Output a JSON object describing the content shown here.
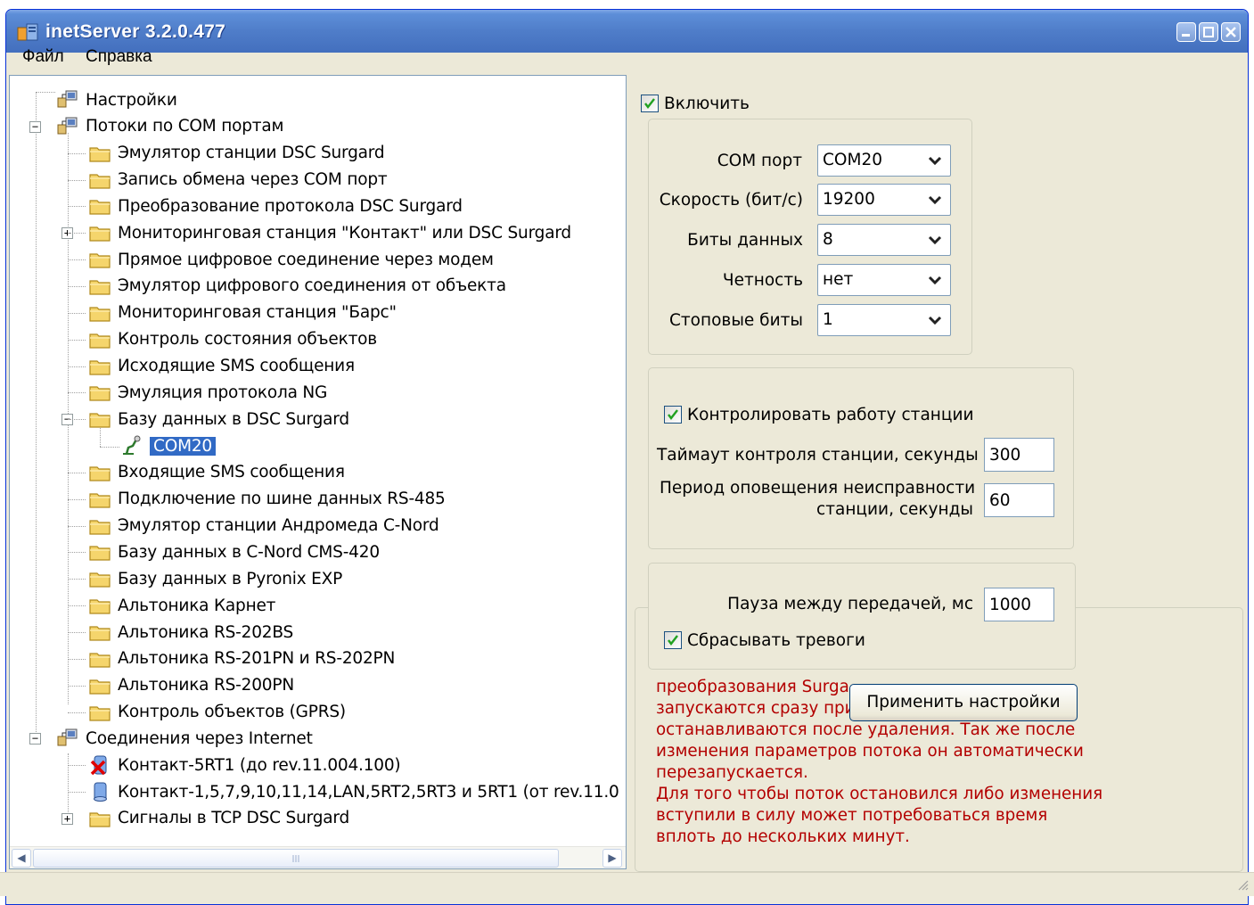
{
  "window": {
    "title": "inetServer 3.2.0.477"
  },
  "menu": {
    "file": "Файл",
    "help": "Справка"
  },
  "tree": {
    "settings": "Настройки",
    "com_streams": "Потоки по COM портам",
    "com_children": [
      "Эмулятор станции DSC Surgard",
      "Запись обмена через COM порт",
      "Преобразование протокола DSC Surgard",
      "Мониторинговая станция \"Контакт\" или DSC Surgard",
      "Прямое цифровое соединение через модем",
      "Эмулятор цифрового соединения от объекта",
      "Мониторинговая станция \"Барс\"",
      "Контроль состояния объектов",
      "Исходящие SMS сообщения",
      "Эмуляция протокола NG",
      "Базу данных в DSC Surgard"
    ],
    "selected_port": "COM20",
    "com_children_after": [
      "Входящие SMS сообщения",
      "Подключение по шине данных RS-485",
      "Эмулятор станции Андромеда C-Nord",
      "Базу данных в C-Nord CMS-420",
      "Базу данных в Pyronix EXP",
      "Альтоника Карнет",
      "Альтоника RS-202BS",
      "Альтоника RS-201PN и RS-202PN",
      "Альтоника RS-200PN",
      "Контроль объектов (GPRS)"
    ],
    "internet": "Соединения через Internet",
    "internet_children": [
      "Контакт-5RT1 (до rev.11.004.100)",
      "Контакт-1,5,7,9,10,11,14,LAN,5RT2,5RT3 и 5RT1 (от rev.11.0",
      "Сигналы в TCP DSC Surgard"
    ]
  },
  "settings": {
    "enable_label": "Включить",
    "enable_checked": true,
    "com_port_label": "COM порт",
    "com_port_value": "COM20",
    "speed_label": "Скорость (бит/с)",
    "speed_value": "19200",
    "data_bits_label": "Биты данных",
    "data_bits_value": "8",
    "parity_label": "Четность",
    "parity_value": "нет",
    "stop_bits_label": "Стоповые биты",
    "stop_bits_value": "1",
    "monitor_label": "Контролировать работу станции",
    "monitor_checked": true,
    "timeout_label": "Таймаут контроля станции, секунды",
    "timeout_value": "300",
    "notify_label_1": "Период оповещения неисправности",
    "notify_label_2": "станции, секунды",
    "notify_value": "60",
    "pause_label": "Пауза между передачей, мс",
    "pause_value": "1000",
    "reset_alarms_label": "Сбрасывать тревоги",
    "reset_alarms_checked": true,
    "apply_button": "Применить настройки"
  },
  "info": {
    "line1": "преобразования Surga",
    "line2": "запускаются сразу при",
    "line3": "останавливаются после удаления. Так же после",
    "line4": "изменения параметров потока он автоматически",
    "line5": "перезапускается.",
    "line6": "Для того чтобы поток остановился либо изменения",
    "line7": "вступили в силу может потребоваться время",
    "line8": "вплоть до нескольких минут."
  },
  "colors": {
    "title_bar": "#4f7dc9",
    "selection": "#316ac5",
    "info_text": "#b30000",
    "window_bg": "#ece9d8"
  }
}
